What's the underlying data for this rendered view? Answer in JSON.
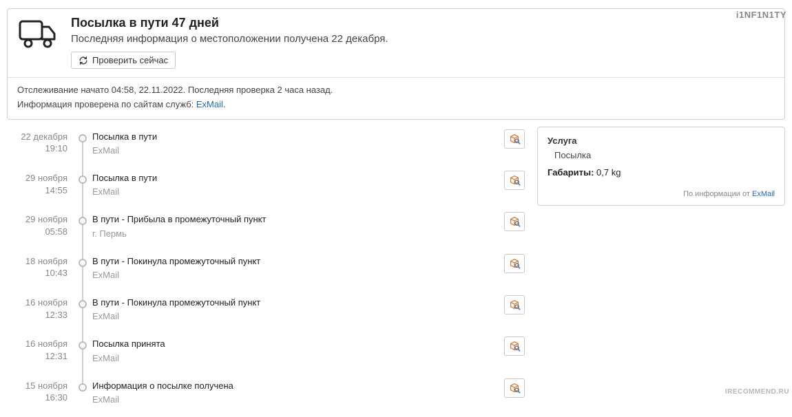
{
  "watermark_top": "i1NF1N1TY",
  "watermark_bottom": "IRECOMMEND.RU",
  "status": {
    "title": "Посылка в пути 47 дней",
    "subtitle": "Последняя информация о местоположении получена 22 декабря.",
    "refresh_label": "Проверить сейчас",
    "info_line1": "Отслеживание начато 04:58, 22.11.2022. Последняя проверка 2 часа назад.",
    "info_line2_prefix": "Информация проверена по сайтам служб: ",
    "info_line2_link": "ExMail",
    "info_line2_suffix": "."
  },
  "timeline": [
    {
      "date": "22 декабря",
      "time": "19:10",
      "status": "Посылка в пути",
      "carrier": "ExMail"
    },
    {
      "date": "29 ноября",
      "time": "14:55",
      "status": "Посылка в пути",
      "carrier": "ExMail"
    },
    {
      "date": "29 ноября",
      "time": "05:58",
      "status": "В пути - Прибыла в промежуточный пункт",
      "carrier": "г. Пермь"
    },
    {
      "date": "18 ноября",
      "time": "10:43",
      "status": "В пути - Покинула промежуточный пункт",
      "carrier": "ExMail"
    },
    {
      "date": "16 ноября",
      "time": "12:33",
      "status": "В пути - Покинула промежуточный пункт",
      "carrier": "ExMail"
    },
    {
      "date": "16 ноября",
      "time": "12:31",
      "status": "Посылка принята",
      "carrier": "ExMail"
    },
    {
      "date": "15 ноября",
      "time": "16:30",
      "status": "Информация о посылке получена",
      "carrier": "ExMail"
    }
  ],
  "service": {
    "title": "Услуга",
    "type": "Посылка",
    "dimensions_label": "Габариты:",
    "dimensions_value": "0,7 kg",
    "source_prefix": "По информации от ",
    "source_link": "ExMail"
  }
}
